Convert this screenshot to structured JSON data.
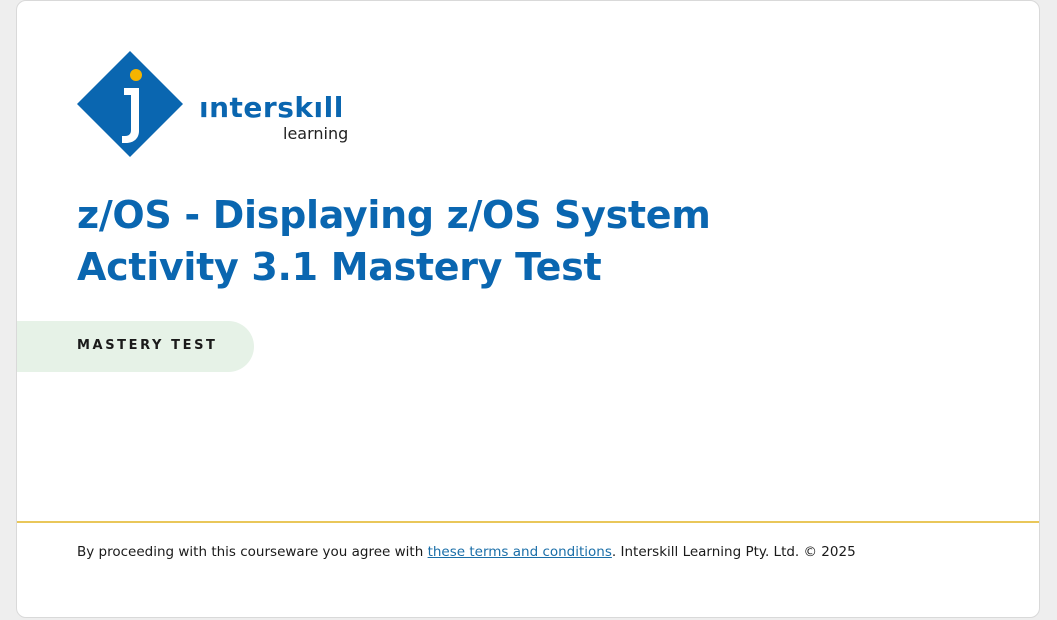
{
  "brand": {
    "wordmark": "ınterskıll",
    "sub": "learning",
    "colors": {
      "blue": "#0a66b0",
      "dot": "#f5b400"
    }
  },
  "title": {
    "line1": "z/OS - Displaying z/OS System",
    "line2": "Activity 3.1 Mastery Test"
  },
  "badge": {
    "label": "MASTERY TEST",
    "color": "#e6f2e7"
  },
  "footer": {
    "prefix": "By proceeding with this courseware you agree with ",
    "link": "these terms and conditions",
    "suffix": ". Interskill Learning Pty. Ltd. © 2025",
    "divider_color": "#e9c75a"
  }
}
